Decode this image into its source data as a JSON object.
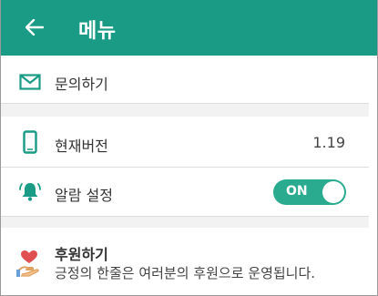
{
  "header": {
    "title": "메뉴",
    "back_icon": "arrow-left-icon",
    "color": "#1a9b86"
  },
  "menu": {
    "inquiry": {
      "label": "문의하기",
      "icon": "mail-icon"
    },
    "version": {
      "label": "현재버전",
      "value": "1.19",
      "icon": "phone-icon"
    },
    "alarm": {
      "label": "알람 설정",
      "toggle_label": "ON",
      "icon": "bell-icon",
      "enabled": true
    },
    "donate": {
      "title": "후원하기",
      "description": "긍정의 한줄은 여러분의 후원으로 운영됩니다.",
      "icon": "heart-hand-icon"
    }
  },
  "accent_color": "#2aaa8e"
}
